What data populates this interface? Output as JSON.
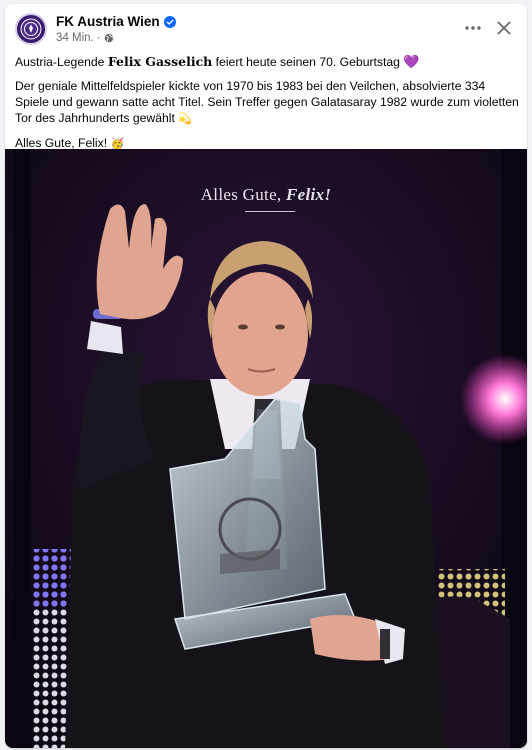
{
  "post": {
    "page_name": "FK Austria Wien",
    "time": "34 Min.",
    "separator": "·",
    "icons": {
      "verified": "verified-badge-icon",
      "audience": "globe-icon",
      "more": "more-options-icon",
      "close": "close-icon"
    },
    "text": {
      "line1_prefix": "Austria-Legende ",
      "line1_bold": "Felix Gasselich",
      "line1_suffix": " feiert heute seinen 70. Geburtstag ",
      "line1_emoji": "💜",
      "para2": "Der geniale Mittelfeldspieler kickte von 1970 bis 1983 bei den Veilchen, absolvierte 334 Spiele und gewann satte acht Titel. Sein Treffer gegen Galatasaray 1982 wurde zum violetten Tor des Jahrhunderts gewählt ",
      "para2_emoji": "💫",
      "para3": "Alles Gute, Felix! ",
      "para3_emoji": "🥳"
    },
    "image": {
      "caption_prefix": "Alles Gute, ",
      "caption_name": "Felix!"
    }
  },
  "colors": {
    "brand": "#3a1a6e",
    "link_blue": "#0866ff",
    "heart": "#8a3ff0",
    "background": "#f0f2f5"
  }
}
